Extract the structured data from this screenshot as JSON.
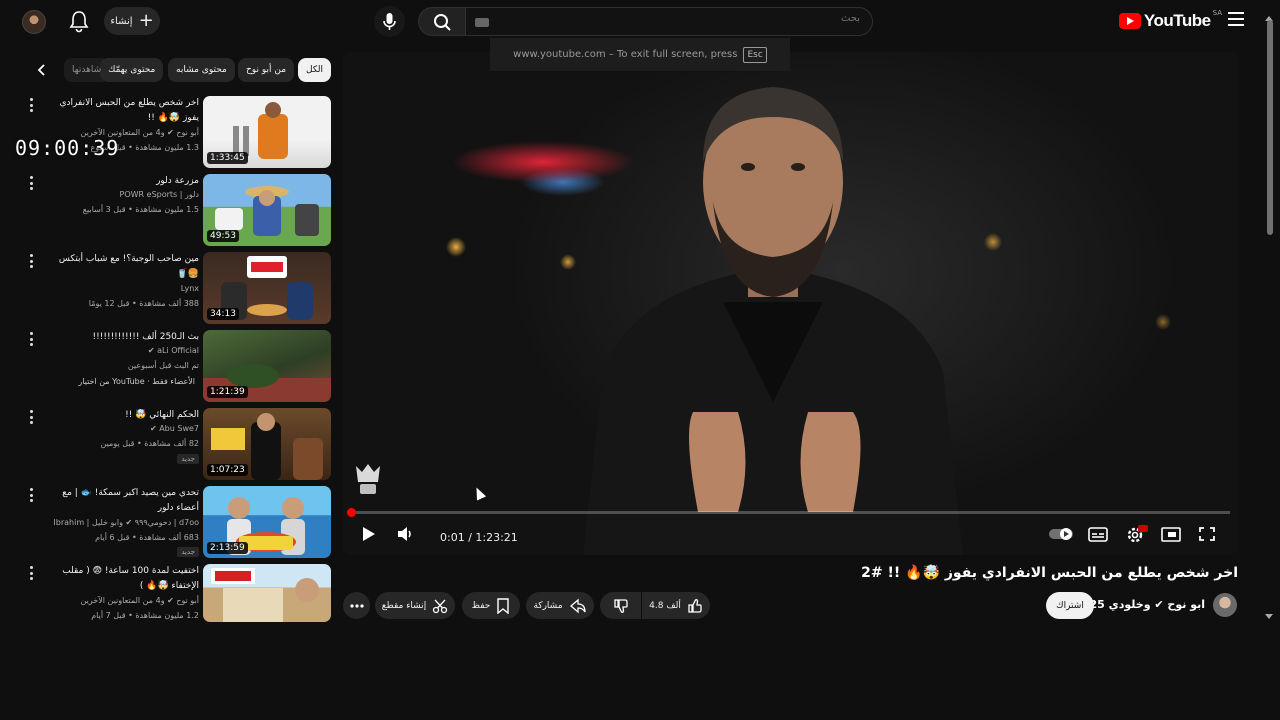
{
  "header": {
    "logo_text": "YouTube",
    "country_code": "SA",
    "search_placeholder": "بحث",
    "create_label": "إنشاء"
  },
  "fullscreen_hint": {
    "text": "www.youtube.com – To exit full screen, press",
    "key": "Esc"
  },
  "chips": [
    "الكل",
    "من أبو نوح",
    "محتوى مشابه",
    "محتوى يهمّك",
    "شاهدتها"
  ],
  "overlay_clock": "09:00:39",
  "recommendations": [
    {
      "title": "اخر شخص يطلع من الحبس الانفرادي يفوز 🤯🔥 !!",
      "channel": "أبو نوح ✔ و4 من المتعاونين الآخرين",
      "meta": "1.3 مليون مشاهدة • قبل أسبوع",
      "duration": "1:33:45",
      "badge": ""
    },
    {
      "title": "مزرعة دلور",
      "channel": "دلور | POWR eSports",
      "meta": "1.5 مليون مشاهدة • قبل 3 أسابيع",
      "duration": "49:53",
      "badge": ""
    },
    {
      "title": "مين صاحب الوجبة؟! مع شباب أبتكس 🍔🥤",
      "channel": "Lynx",
      "meta": "388 ألف مشاهدة • قبل 12 يومًا",
      "duration": "34:13",
      "badge": ""
    },
    {
      "title": "بث الـ250 ألف !!!!!!!!!!!!!",
      "channel": "aLi Official ✔",
      "meta": "تم البث قبل أسبوعين",
      "duration": "1:21:39",
      "badge": "من اختيار YouTube · الأعضاء فقط"
    },
    {
      "title": "الحكم النهائي 🤯 !!",
      "channel": "Abu Swe7 ✔",
      "meta": "82 ألف مشاهدة • قبل يومين",
      "duration": "1:07:23",
      "badge": "جديد"
    },
    {
      "title": "تحدي مين يصيد اكبر سمكة! 🐟 | مع أعضاء دلور",
      "channel": "d7oo | دحومي٩٩٩ ✔ وابو خليل | Ibrahim",
      "meta": "683 ألف مشاهدة • قبل 6 أيام",
      "duration": "2:13:59",
      "badge": "جديد"
    },
    {
      "title": "اختفيت لمدة 100 ساعة! 😨 ( مقلب الإختفاء 🤯🔥 )",
      "channel": "أبو نوح ✔ و4 من المتعاونين الآخرين",
      "meta": "1.2 مليون مشاهدة • قبل 7 أيام",
      "duration": "",
      "badge": ""
    }
  ],
  "player": {
    "current_time": "0:01",
    "duration": "1:23:21",
    "time_display": "0:01 / 1:23:21",
    "progress": 0.0002,
    "hd_badge": "HD"
  },
  "video": {
    "title": "اخر شخص يطلع من الحبس الانفرادي يفوز 🤯🔥 !! #2",
    "channel": "ابو نوح ✔ وخلودي 25",
    "subscribe_label": "اشتراك",
    "likes": "4.8 ألف",
    "share_label": "مشاركة",
    "save_label": "حفظ",
    "clip_label": "إنشاء مقطع"
  },
  "colors": {
    "background": "#0f0f0f",
    "accent_red": "#ff0000",
    "chip_bg": "#272727"
  },
  "icons": [
    "hamburger-icon",
    "youtube-logo-icon",
    "search-icon",
    "mic-icon",
    "plus-icon",
    "bell-icon",
    "play-icon",
    "volume-icon",
    "autoplay-icon",
    "subtitles-icon",
    "settings-icon",
    "miniplayer-icon",
    "fullscreen-icon",
    "like-icon",
    "dislike-icon",
    "share-icon",
    "save-icon",
    "scissors-icon",
    "more-icon"
  ]
}
